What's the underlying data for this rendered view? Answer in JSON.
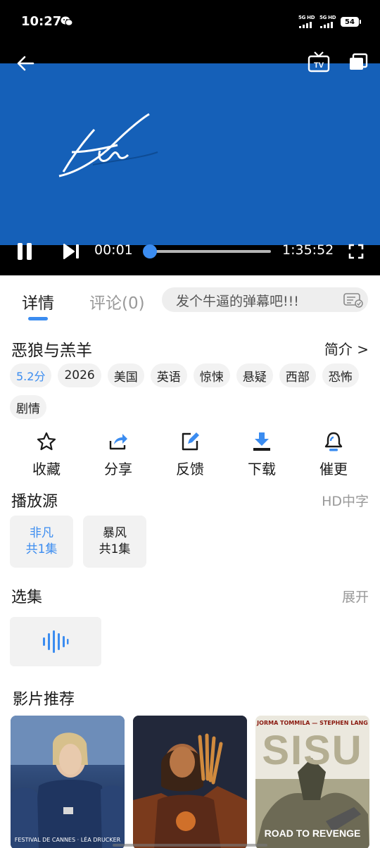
{
  "status_bar": {
    "time": "10:27",
    "network_1": "5G HD",
    "network_2": "5G HD",
    "battery": "54"
  },
  "player": {
    "current_time": "00:01",
    "duration": "1:35:52",
    "progress": 0.0002,
    "icons": [
      "back-arrow-icon",
      "tv-cast-icon",
      "picture-in-picture-icon",
      "pause-icon",
      "next-icon",
      "fullscreen-icon"
    ]
  },
  "tabs": {
    "detail": "详情",
    "comments": "评论(0)",
    "danmaku_placeholder": "发个牛逼的弹幕吧!!!"
  },
  "movie": {
    "title": "恶狼与羔羊",
    "intro_link": "简介 >",
    "tags": [
      "5.2分",
      "2026",
      "美国",
      "英语",
      "惊悚",
      "悬疑",
      "西部",
      "恐怖",
      "剧情"
    ]
  },
  "actions": [
    {
      "label": "收藏",
      "icon": "star-icon"
    },
    {
      "label": "分享",
      "icon": "share-icon"
    },
    {
      "label": "反馈",
      "icon": "edit-icon"
    },
    {
      "label": "下载",
      "icon": "download-icon"
    },
    {
      "label": "催更",
      "icon": "bell-icon"
    }
  ],
  "source": {
    "title": "播放源",
    "quality": "HD中字",
    "items": [
      {
        "name": "非凡",
        "count": "共1集",
        "active": true
      },
      {
        "name": "暴风",
        "count": "共1集",
        "active": false
      }
    ]
  },
  "episodes": {
    "title": "选集",
    "expand": "展开"
  },
  "recommend": {
    "title": "影片推荐",
    "posters": [
      {
        "top_text": "",
        "bottom_text": "FESTIVAL DE CANNES · LÉA DRUCKER"
      },
      {
        "top_text": "",
        "bottom_text": ""
      },
      {
        "top_text": "JORMA TOMMILA — STEPHEN LANG",
        "big_text": "SISU",
        "bottom_text": "ROAD TO REVENGE"
      }
    ]
  },
  "colors": {
    "accent": "#3b8cf0",
    "video_bg": "#1560b8"
  }
}
